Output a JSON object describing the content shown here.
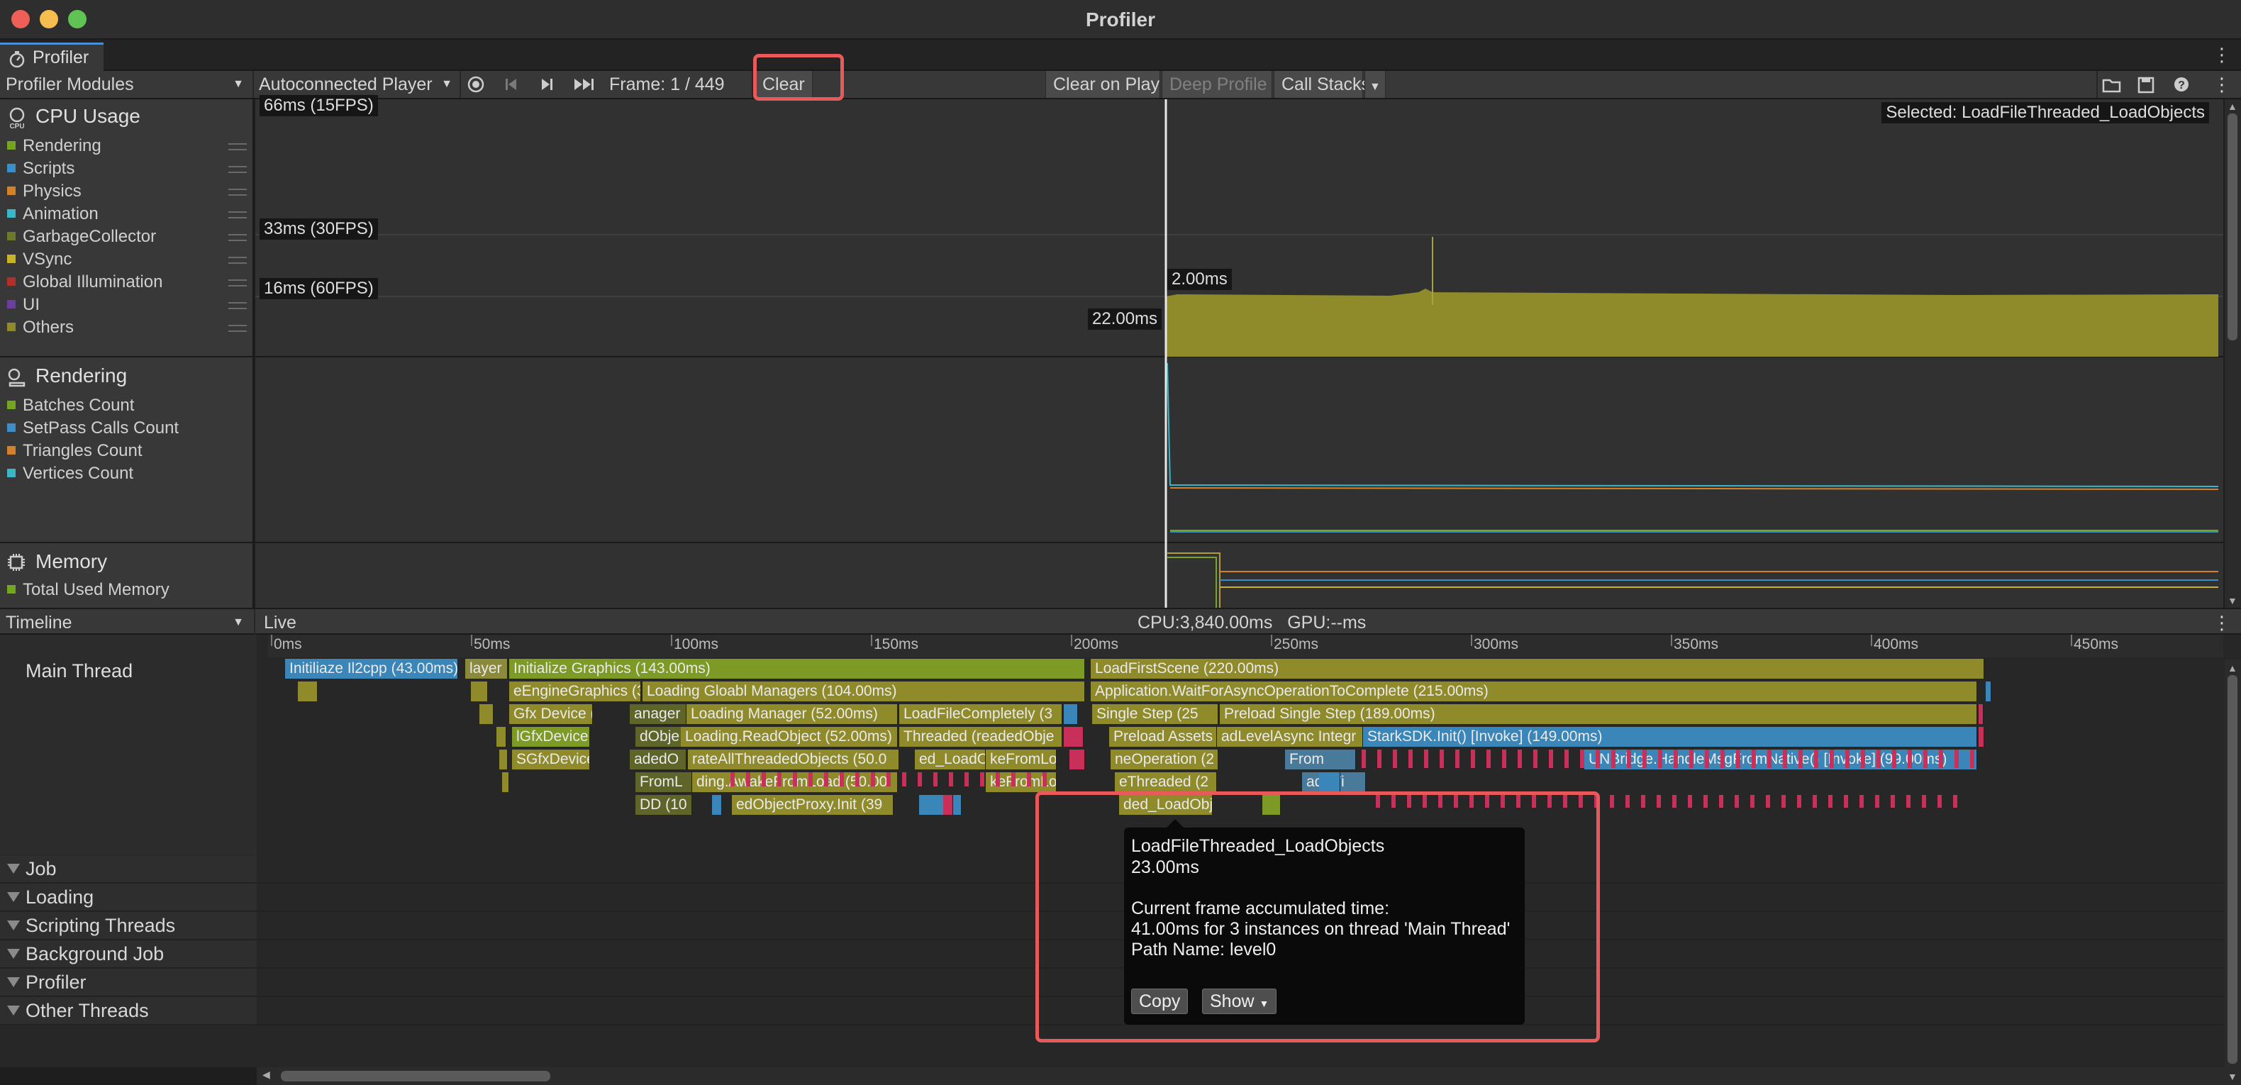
{
  "window": {
    "title": "Profiler"
  },
  "tab": {
    "label": "Profiler"
  },
  "toolbar": {
    "modules_dropdown": "Profiler Modules",
    "player_dropdown": "Autoconnected Player",
    "frame_label": "Frame: 1 / 449",
    "clear": "Clear",
    "clear_on_play": "Clear on Play",
    "deep_profile": "Deep Profile",
    "call_stacks": "Call Stacks"
  },
  "cpu_module": {
    "title": "CPU Usage",
    "legend": [
      {
        "label": "Rendering",
        "color": "#76a51f"
      },
      {
        "label": "Scripts",
        "color": "#3a8fc8"
      },
      {
        "label": "Physics",
        "color": "#d3812b"
      },
      {
        "label": "Animation",
        "color": "#3bb5c8"
      },
      {
        "label": "GarbageCollector",
        "color": "#6d7a2a"
      },
      {
        "label": "VSync",
        "color": "#c8b22a"
      },
      {
        "label": "Global Illumination",
        "color": "#b0302a"
      },
      {
        "label": "UI",
        "color": "#6a3f9e"
      },
      {
        "label": "Others",
        "color": "#8f8a2a"
      }
    ],
    "markers": {
      "m66": "66ms (15FPS)",
      "m33": "33ms (30FPS)",
      "m16": "16ms (60FPS)"
    },
    "selected": "Selected: LoadFileThreaded_LoadObjects",
    "value_top": "2.00ms",
    "value_left": "22.00ms"
  },
  "rendering_module": {
    "title": "Rendering",
    "legend": [
      {
        "label": "Batches Count",
        "color": "#76a51f"
      },
      {
        "label": "SetPass Calls Count",
        "color": "#3a8fc8"
      },
      {
        "label": "Triangles Count",
        "color": "#d3812b"
      },
      {
        "label": "Vertices Count",
        "color": "#3bb5c8"
      }
    ]
  },
  "memory_module": {
    "title": "Memory",
    "legend": [
      {
        "label": "Total Used Memory",
        "color": "#76a51f"
      }
    ]
  },
  "timeline": {
    "view_dropdown": "Timeline",
    "live": "Live",
    "cpu_gpu": "CPU:3,840.00ms   GPU:--ms",
    "ruler": [
      "0ms",
      "50ms",
      "100ms",
      "150ms",
      "200ms",
      "250ms",
      "300ms",
      "350ms",
      "400ms",
      "450ms"
    ],
    "main_thread": "Main Thread",
    "groups": [
      "Job",
      "Loading",
      "Scripting Threads",
      "Background Job",
      "Profiler",
      "Other Threads"
    ],
    "bars": {
      "b0": "Initiliaze Il2cpp (43.00ms)",
      "b1": "layer",
      "b2": "Initialize Graphics (143.00ms)",
      "b3": "LoadFirstScene (220.00ms)",
      "b4": "eEngineGraphics (33",
      "b5": "Loading Gloabl Managers (104.00ms)",
      "b6": "Application.WaitForAsyncOperationToComplete (215.00ms)",
      "b7": "Gfx Device (",
      "b8": "anager",
      "b9": "Loading Manager (52.00ms)",
      "b10": "LoadFileCompletely (3",
      "b11": "Single Step (25",
      "b12": "Preload Single Step (189.00ms)",
      "b13": "lGfxDevice",
      "b14": "dObje",
      "b15": "Loading.ReadObject (52.00ms)",
      "b16": "Threaded (readedObje",
      "b17": "Preload Assets",
      "b18": "adLevelAsync Integr",
      "b19": "StarkSDK.Init() [Invoke] (149.00ms)",
      "b20": "SGfxDevice",
      "b21": "adedO",
      "b22": "rateAllThreadedObjects (50.0",
      "b23": "ed_LoadOb",
      "b24": "keFromLo",
      "b25": "neOperation (2",
      "b26": "From",
      "b27": "UNBridge.HandleMsgFromNative() [Invoke] (99.00ms)",
      "b28": "FromL",
      "b29": "ding.AwakeFromLoad (50.00",
      "b30": "keFromLo",
      "b31": "eThreaded (2",
      "b32": "ad Wi",
      "b33": "DD (10",
      "b34": "edObjectProxy.Init (39",
      "b35": "ded_LoadObj"
    }
  },
  "tooltip": {
    "name": "LoadFileThreaded_LoadObjects",
    "time": "23.00ms",
    "accum_label": "Current frame accumulated time:",
    "accum_value": "41.00ms for 3 instances on thread 'Main Thread'",
    "path": "Path Name: level0",
    "copy": "Copy",
    "show": "Show"
  }
}
